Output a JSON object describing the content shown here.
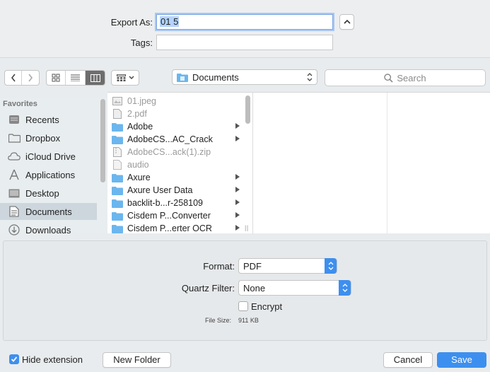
{
  "export": {
    "label": "Export As:",
    "value": "01 5",
    "tags_label": "Tags:",
    "tags_value": ""
  },
  "toolbar": {
    "location": "Documents",
    "search_placeholder": "Search"
  },
  "sidebar": {
    "heading": "Favorites",
    "items": [
      {
        "label": "Recents",
        "icon": "recents-icon"
      },
      {
        "label": "Dropbox",
        "icon": "folder-icon"
      },
      {
        "label": "iCloud Drive",
        "icon": "cloud-icon"
      },
      {
        "label": "Applications",
        "icon": "applications-icon"
      },
      {
        "label": "Desktop",
        "icon": "desktop-icon"
      },
      {
        "label": "Documents",
        "icon": "documents-icon",
        "selected": true
      },
      {
        "label": "Downloads",
        "icon": "downloads-icon"
      }
    ]
  },
  "files": [
    {
      "name": "01.jpeg",
      "kind": "image",
      "dim": true
    },
    {
      "name": "2.pdf",
      "kind": "pdf",
      "dim": true
    },
    {
      "name": "Adobe",
      "kind": "folder",
      "dim": false
    },
    {
      "name": "AdobeCS...AC_Crack",
      "kind": "folder",
      "dim": false
    },
    {
      "name": "AdobeCS...ack(1).zip",
      "kind": "zip",
      "dim": true
    },
    {
      "name": "audio",
      "kind": "file",
      "dim": true
    },
    {
      "name": "Axure",
      "kind": "folder",
      "dim": false
    },
    {
      "name": "Axure User Data",
      "kind": "folder",
      "dim": false
    },
    {
      "name": "backlit-b...r-258109",
      "kind": "folder",
      "dim": false
    },
    {
      "name": "Cisdem P...Converter",
      "kind": "folder",
      "dim": false
    },
    {
      "name": "Cisdem P...erter OCR",
      "kind": "folder",
      "dim": false
    }
  ],
  "options": {
    "format_label": "Format:",
    "format_value": "PDF",
    "filter_label": "Quartz Filter:",
    "filter_value": "None",
    "encrypt_label": "Encrypt",
    "filesize_label": "File Size:",
    "filesize_value": "911 KB"
  },
  "footer": {
    "hide_extension_label": "Hide extension",
    "new_folder_label": "New Folder",
    "cancel_label": "Cancel",
    "save_label": "Save"
  },
  "colors": {
    "accent": "#3d8fef",
    "folder": "#6bb6ee",
    "selection": "#b3d3fc"
  }
}
